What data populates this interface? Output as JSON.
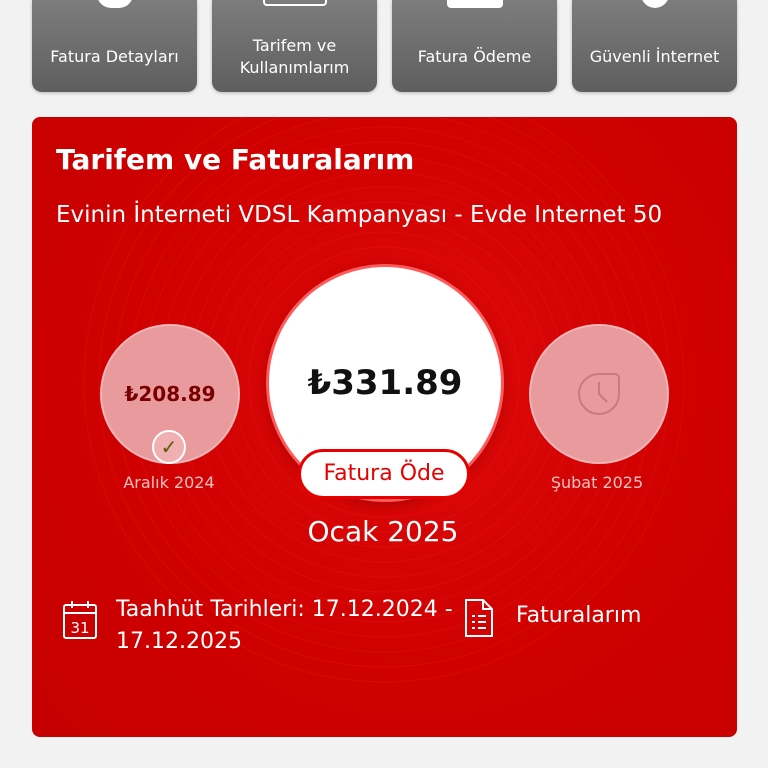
{
  "tiles": [
    {
      "label": "Fatura Detayları"
    },
    {
      "label": "Tarifem ve Kullanımlarım"
    },
    {
      "label": "Fatura Ödeme"
    },
    {
      "label": "Güvenli İnternet"
    }
  ],
  "card": {
    "title": "Tarifem ve Faturalarım",
    "subtitle": "Evinin İnterneti VDSL Kampanyası - Evde Internet 50",
    "previous": {
      "amount": "₺208.89",
      "month": "Aralık 2024",
      "status_icon": "check-icon"
    },
    "current": {
      "amount": "₺331.89",
      "month": "Ocak 2025",
      "pay_label": "Fatura Öde"
    },
    "next": {
      "month": "Şubat 2025",
      "icon": "clock-icon"
    },
    "commitment": {
      "label": "Taahhüt Tarihleri: 17.12.2024 - 17.12.2025",
      "calendar_day": "31"
    },
    "invoices_link": "Faturalarım"
  },
  "colors": {
    "brand_red": "#e60000",
    "tile_gray": "#6e6e6e",
    "background": "#f2f2f2"
  }
}
